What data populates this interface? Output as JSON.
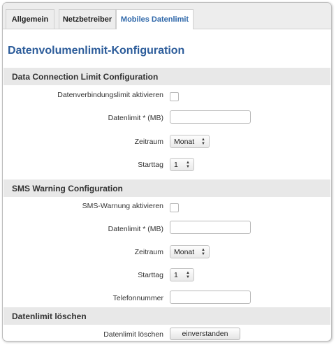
{
  "tabs": [
    {
      "label": "Allgemein"
    },
    {
      "label": "Netzbetreiber"
    },
    {
      "label": "Mobiles Datenlimit"
    }
  ],
  "page_title": "Datenvolumenlimit-Konfiguration",
  "data_limit_section": {
    "title": "Data Connection Limit Configuration",
    "enable_label": "Datenverbindungslimit aktivieren",
    "limit_label": "Datenlimit * (MB)",
    "limit_value": "",
    "period_label": "Zeitraum",
    "period_value": "Monat",
    "start_label": "Starttag",
    "start_value": "1"
  },
  "sms_section": {
    "title": "SMS Warning Configuration",
    "enable_label": "SMS-Warnung aktivieren",
    "limit_label": "Datenlimit * (MB)",
    "limit_value": "",
    "period_label": "Zeitraum",
    "period_value": "Monat",
    "start_label": "Starttag",
    "start_value": "1",
    "phone_label": "Telefonnummer",
    "phone_value": ""
  },
  "clear_section": {
    "title": "Datenlimit löschen",
    "clear_label": "Datenlimit löschen",
    "button_label": "einverstanden"
  },
  "colors": {
    "accent": "#2c5c9a",
    "section_bg": "#e8e8e8"
  }
}
